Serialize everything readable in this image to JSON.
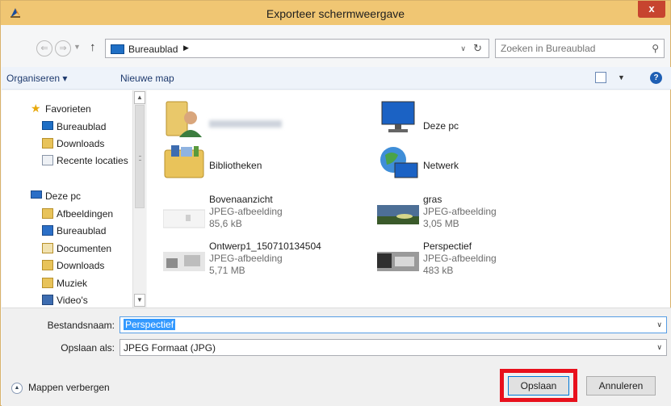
{
  "window": {
    "title": "Exporteer schermweergave",
    "close_label": "x"
  },
  "address": {
    "crumb": "Bureaublad",
    "crumb_arrow": "▶"
  },
  "search": {
    "placeholder": "Zoeken in Bureaublad"
  },
  "toolbar": {
    "organize_label": "Organiseren ▾",
    "new_folder_label": "Nieuwe map",
    "help_label": "?"
  },
  "navpane": {
    "favorites": {
      "label": "Favorieten",
      "items": [
        "Bureaublad",
        "Downloads",
        "Recente locaties"
      ]
    },
    "this_pc": {
      "label": "Deze pc",
      "items": [
        "Afbeeldingen",
        "Bureaublad",
        "Documenten",
        "Downloads",
        "Muziek",
        "Video's"
      ]
    }
  },
  "files": [
    {
      "name": "",
      "type": "",
      "size": ""
    },
    {
      "name": "Deze pc",
      "type": "",
      "size": ""
    },
    {
      "name": "Bibliotheken",
      "type": "",
      "size": ""
    },
    {
      "name": "Netwerk",
      "type": "",
      "size": ""
    },
    {
      "name": "Bovenaanzicht",
      "type": "JPEG-afbeelding",
      "size": "85,6 kB"
    },
    {
      "name": "gras",
      "type": "JPEG-afbeelding",
      "size": "3,05 MB"
    },
    {
      "name": "Ontwerp1_150710134504",
      "type": "JPEG-afbeelding",
      "size": "5,71 MB"
    },
    {
      "name": "Perspectief",
      "type": "JPEG-afbeelding",
      "size": "483 kB"
    }
  ],
  "form": {
    "filename_label": "Bestandsnaam:",
    "filename_value": "Perspectief",
    "filetype_label": "Opslaan als:",
    "filetype_value": "JPEG Formaat (JPG)"
  },
  "footer": {
    "hide_folders_label": "Mappen verbergen",
    "save_label": "Opslaan",
    "cancel_label": "Annuleren"
  },
  "colors": {
    "titlebar": "#f0c673",
    "close": "#c7442f",
    "highlight_outline": "#e8101c",
    "selection": "#3399ff"
  }
}
